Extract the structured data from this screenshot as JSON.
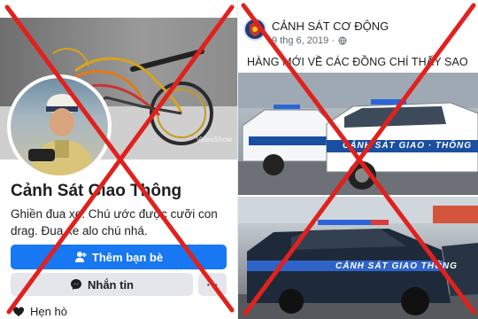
{
  "profile": {
    "cover_watermark": "VideoShow",
    "name": "Cảnh Sát Giao Thông",
    "bio": "Ghiền đua xe. Chú ước được cưỡi con drag. Đua xe alo chú nhá.",
    "add_friend_label": "Thêm bạn bè",
    "message_label": "Nhắn tin",
    "more_label": "···",
    "dating_label": "Hẹn hò"
  },
  "post": {
    "page_name": "CẢNH SÁT CƠ ĐỘNG",
    "date": "9 thg 6, 2019 ·",
    "text": "HÀNG MỚI VỀ CÁC ĐỒNG CHÍ THẤY SAO",
    "car_label_1": "CẢNH SÁT GIAO · THÔNG",
    "car_label_2": "CẢNH SÁT GIAO THÔNG"
  },
  "colors": {
    "facebook_blue": "#1877f2",
    "cross_red": "#e0211d"
  }
}
